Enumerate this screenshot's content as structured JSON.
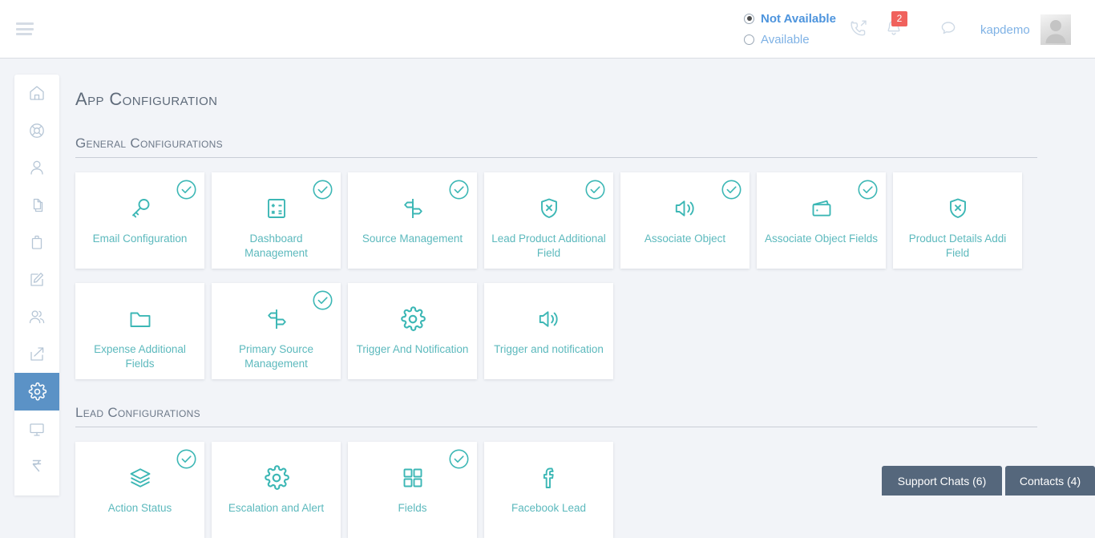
{
  "header": {
    "menu_icon": "hamburger-icon",
    "availability": {
      "not_available_label": "Not Available",
      "available_label": "Available",
      "selected": "Not Available"
    },
    "icons": [
      {
        "name": "phone-outgoing-icon"
      },
      {
        "name": "bell-icon"
      },
      {
        "name": "chat-bubble-icon"
      }
    ],
    "notification_count": "2",
    "username": "kapdemo",
    "avatar": "user-avatar-icon",
    "accent_color": "#4d94dd",
    "badge_color": "#f0625d"
  },
  "sidebar": {
    "active_color": "#5b92c6",
    "items": [
      {
        "icon": "home-icon",
        "active": false
      },
      {
        "icon": "lifebuoy-icon",
        "active": false
      },
      {
        "icon": "user-icon",
        "active": false
      },
      {
        "icon": "documents-icon",
        "active": false
      },
      {
        "icon": "briefcase-icon",
        "active": false
      },
      {
        "icon": "edit-square-icon",
        "active": false
      },
      {
        "icon": "users-icon",
        "active": false
      },
      {
        "icon": "share-export-icon",
        "active": false
      },
      {
        "icon": "gear-icon",
        "active": true
      },
      {
        "icon": "monitor-icon",
        "active": false
      },
      {
        "icon": "rupee-icon",
        "active": false
      }
    ]
  },
  "main": {
    "page_title": "App Configuration",
    "card_color": "#5cb9bd",
    "check_color": "#3cb7b5",
    "sections": [
      {
        "title": "General Configurations",
        "rows": [
          [
            {
              "label": "Email Configuration",
              "icon": "key-icon",
              "checked": true
            },
            {
              "label": "Dashboard Management",
              "icon": "calculator-icon",
              "checked": true
            },
            {
              "label": "Source Management",
              "icon": "signpost-icon",
              "checked": true
            },
            {
              "label": "Lead Product Additional Field",
              "icon": "shield-x-icon",
              "checked": true
            },
            {
              "label": "Associate Object",
              "icon": "speaker-icon",
              "checked": true
            },
            {
              "label": "Associate Object Fields",
              "icon": "wallet-icon",
              "checked": true
            },
            {
              "label": "Product Details Addi Field",
              "icon": "shield-x-icon",
              "checked": false
            }
          ],
          [
            {
              "label": "Expense Additional Fields",
              "icon": "folder-icon",
              "checked": false
            },
            {
              "label": "Primary Source Management",
              "icon": "signpost-icon",
              "checked": true
            },
            {
              "label": "Trigger And Notification",
              "icon": "gear-icon",
              "checked": false
            },
            {
              "label": "Trigger and notification",
              "icon": "speaker-icon",
              "checked": false
            }
          ]
        ]
      },
      {
        "title": "Lead Configurations",
        "rows": [
          [
            {
              "label": "Action Status",
              "icon": "layers-icon",
              "checked": true
            },
            {
              "label": "Escalation and Alert",
              "icon": "gear-icon",
              "checked": false
            },
            {
              "label": "Fields",
              "icon": "grid-icon",
              "checked": true
            },
            {
              "label": "Facebook Lead",
              "icon": "facebook-icon",
              "checked": false
            }
          ]
        ]
      }
    ]
  },
  "bottom_bar": {
    "support_chats_label": "Support Chats (6)",
    "contacts_label": "Contacts (4)",
    "background_color": "#55677c"
  }
}
